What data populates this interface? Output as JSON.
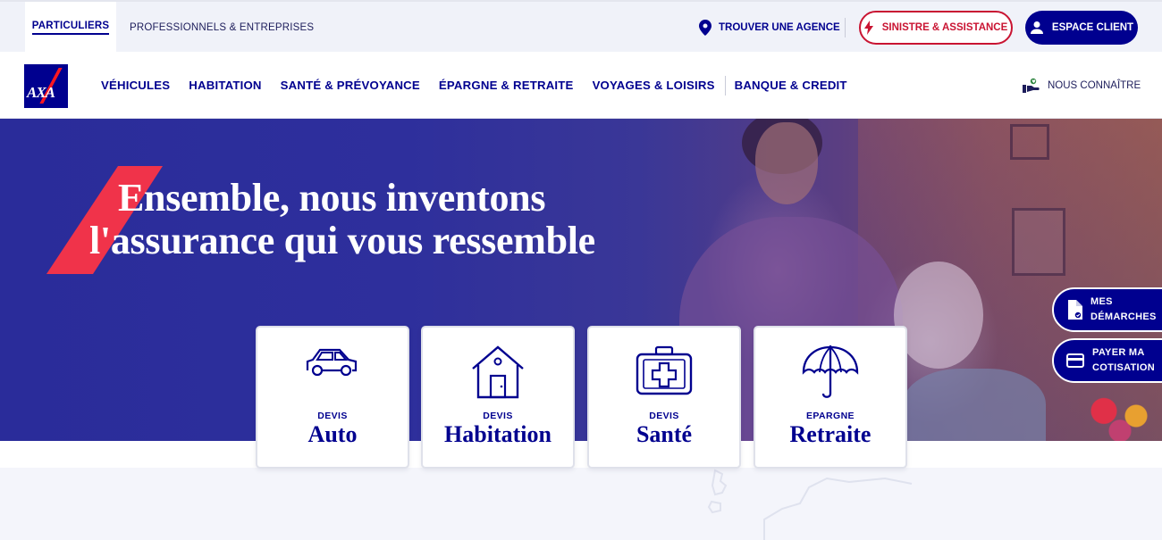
{
  "topbar": {
    "segments": [
      "PARTICULIERS",
      "PROFESSIONNELS & ENTREPRISES"
    ],
    "agency_label": "TROUVER UNE AGENCE",
    "sinistre_label": "SINISTRE & ASSISTANCE",
    "client_label": "ESPACE CLIENT"
  },
  "nav": {
    "logo_text": "AXA",
    "items": [
      "VÉHICULES",
      "HABITATION",
      "SANTÉ & PRÉVOYANCE",
      "ÉPARGNE & RETRAITE",
      "VOYAGES & LOISIRS",
      "BANQUE & CREDIT"
    ],
    "about_label": "NOUS CONNAÎTRE"
  },
  "hero": {
    "line1": "Ensemble, nous inventons",
    "line2": "l'assurance qui vous ressemble"
  },
  "cards": [
    {
      "small": "DEVIS",
      "big": "Auto",
      "icon": "car-icon"
    },
    {
      "small": "DEVIS",
      "big": "Habitation",
      "icon": "house-icon"
    },
    {
      "small": "DEVIS",
      "big": "Santé",
      "icon": "medical-kit-icon"
    },
    {
      "small": "EPARGNE",
      "big": "Retraite",
      "icon": "umbrella-icon"
    }
  ],
  "side_tabs": [
    {
      "line1": "MES",
      "line2": "DÉMARCHES",
      "icon": "document-icon"
    },
    {
      "line1": "PAYER MA",
      "line2": "COTISATION",
      "icon": "card-icon"
    }
  ],
  "colors": {
    "brand_blue": "#00008f",
    "brand_red": "#ff1721",
    "alert_red": "#c91432"
  }
}
